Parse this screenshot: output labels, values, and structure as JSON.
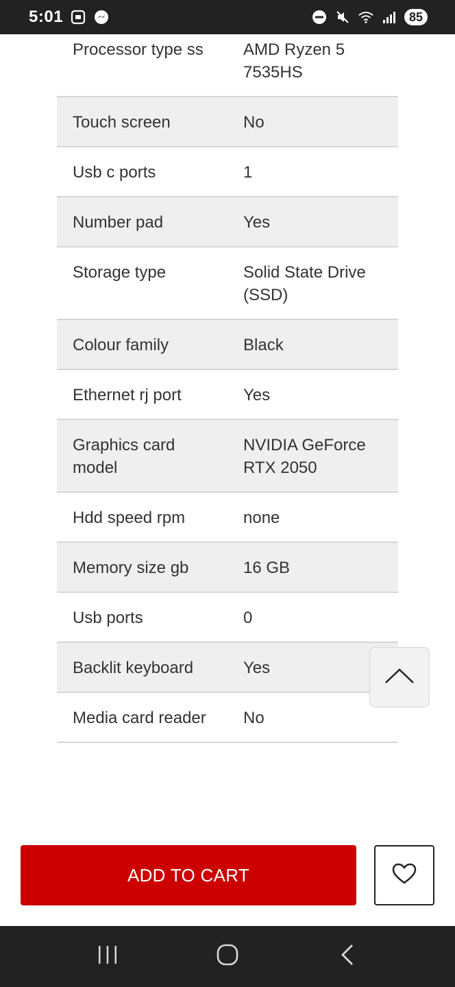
{
  "status_bar": {
    "time": "5:01",
    "battery": "85",
    "icons": [
      "screenshot-icon",
      "messenger-icon",
      "dnd-icon",
      "mute-icon",
      "wifi-icon",
      "signal-icon"
    ]
  },
  "specs": [
    {
      "key": "Processor type ss",
      "value": "AMD Ryzen 5 7535HS",
      "shaded": false
    },
    {
      "key": "Touch screen",
      "value": "No",
      "shaded": true
    },
    {
      "key": "Usb c ports",
      "value": "1",
      "shaded": false
    },
    {
      "key": "Number pad",
      "value": "Yes",
      "shaded": true
    },
    {
      "key": "Storage type",
      "value": "Solid State Drive (SSD)",
      "shaded": false
    },
    {
      "key": "Colour family",
      "value": "Black",
      "shaded": true
    },
    {
      "key": "Ethernet rj port",
      "value": "Yes",
      "shaded": false
    },
    {
      "key": "Graphics card model",
      "value": "NVIDIA GeForce RTX 2050",
      "shaded": true
    },
    {
      "key": "Hdd speed rpm",
      "value": "none",
      "shaded": false
    },
    {
      "key": "Memory size gb",
      "value": "16 GB",
      "shaded": true
    },
    {
      "key": "Usb ports",
      "value": "0",
      "shaded": false
    },
    {
      "key": "Backlit keyboard",
      "value": "Yes",
      "shaded": true
    },
    {
      "key": "Media card reader",
      "value": "No",
      "shaded": false
    }
  ],
  "actions": {
    "add_to_cart_label": "ADD TO CART",
    "wishlist_icon": "heart-icon",
    "scroll_top_icon": "chevron-up-icon"
  },
  "nav": {
    "icons": [
      "recents-icon",
      "home-icon",
      "back-icon"
    ]
  },
  "colors": {
    "accent": "#cc0000",
    "bar_background": "#222222",
    "row_shade": "#efefef"
  }
}
